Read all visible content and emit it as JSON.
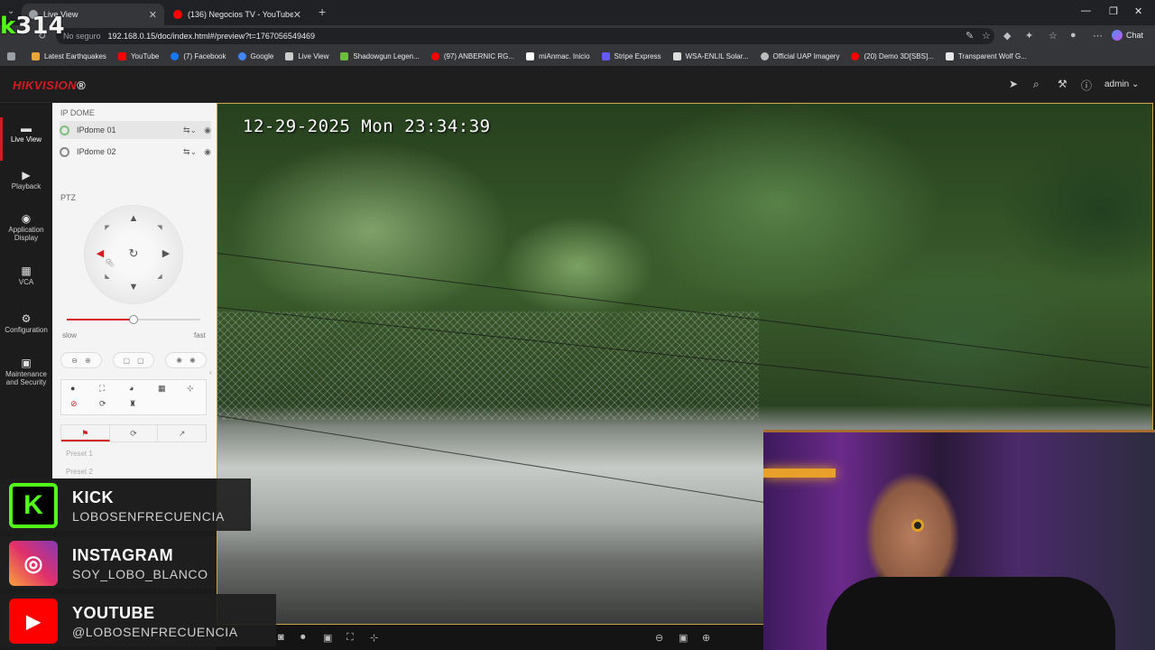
{
  "browser": {
    "tabs": [
      {
        "title": "Live View",
        "active": true
      },
      {
        "title": "(136) Negocios TV - YouTube",
        "active": false
      }
    ],
    "address": {
      "security_label": "No seguro",
      "url": "192.168.0.15/doc/index.html#/preview?t=1767056549469"
    },
    "chat_label": "Chat",
    "bookmarks": [
      {
        "label": "Latest Earthquakes",
        "color": "#e8a63a"
      },
      {
        "label": "YouTube",
        "color": "#ff0000"
      },
      {
        "label": "(7) Facebook",
        "color": "#1877f2"
      },
      {
        "label": "Google",
        "color": "#4285f4"
      },
      {
        "label": "Live View",
        "color": "#cccccc"
      },
      {
        "label": "Shadowgun Legen...",
        "color": "#6bbf3a"
      },
      {
        "label": "(97) ANBERNIC RG...",
        "color": "#ff0000"
      },
      {
        "label": "miAnmac. Inicio",
        "color": "#ffffff"
      },
      {
        "label": "Stripe Express",
        "color": "#635bff"
      },
      {
        "label": "WSA-ENLIL Solar...",
        "color": "#dddddd"
      },
      {
        "label": "Official UAP Imagery",
        "color": "#bbbbbb"
      },
      {
        "label": "(20) Demo 3D[SBS]...",
        "color": "#ff0000"
      },
      {
        "label": "Transparent Wolf G...",
        "color": "#e8e8e8"
      }
    ]
  },
  "app": {
    "brand": "HIKVISION",
    "user": "admin",
    "nav": [
      {
        "label": "Live View",
        "active": true
      },
      {
        "label": "Playback"
      },
      {
        "label": "Application Display"
      },
      {
        "label": "VCA"
      },
      {
        "label": "Configuration"
      },
      {
        "label": "Maintenance and Security"
      }
    ],
    "panel": {
      "group_title": "IP DOME",
      "cameras": [
        "IPdome 01",
        "IPdome 02"
      ],
      "ptz_title": "PTZ",
      "speed_slow": "slow",
      "speed_fast": "fast",
      "speed_level": 0.5,
      "presets": [
        "Preset 1",
        "Preset 2"
      ]
    },
    "osd_timestamp": "12-29-2025 Mon 23:34:39"
  },
  "overlay": {
    "counter": "314",
    "social": [
      {
        "platform": "KICK",
        "handle": "LOBOSENFRECUENCIA",
        "color": "#53fc18"
      },
      {
        "platform": "INSTAGRAM",
        "handle": "SOY_LOBO_BLANCO",
        "color": "#e1306c"
      },
      {
        "platform": "YOUTUBE",
        "handle": "@LOBOSENFRECUENCIA",
        "color": "#ff0000"
      }
    ]
  }
}
